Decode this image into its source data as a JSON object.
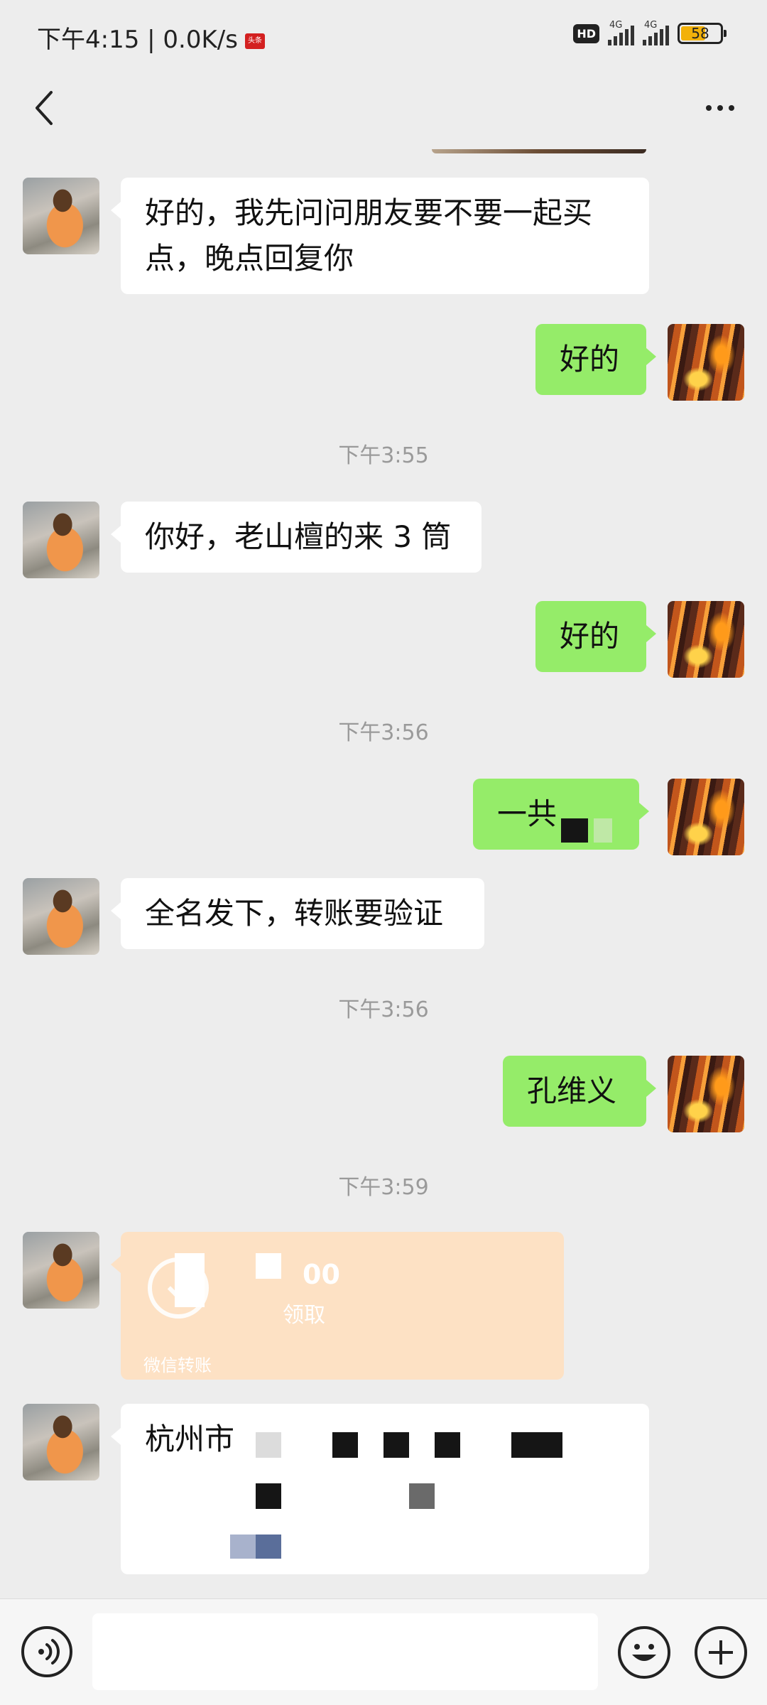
{
  "status_bar": {
    "time_speed": "下午4:15 | 0.0K/s",
    "flag_label": "头条",
    "hd": "HD",
    "network_1": "4G",
    "network_2": "4G",
    "battery": "58"
  },
  "nav": {
    "back_icon": "chevron-left-icon",
    "more_icon": "more-dots-icon"
  },
  "messages": [
    {
      "side": "in",
      "text_line1": "好的，我先问问朋友要不要一起买",
      "text_line2": "点，晚点回复你"
    },
    {
      "side": "out",
      "text": "好的"
    },
    {
      "type": "time",
      "text": "下午3:55"
    },
    {
      "side": "in",
      "text": "你好，老山檀的来 3 筒"
    },
    {
      "side": "out",
      "text": "好的"
    },
    {
      "type": "time",
      "text": "下午3:56"
    },
    {
      "side": "out",
      "text": "一共"
    },
    {
      "side": "in",
      "text": "全名发下，转账要验证"
    },
    {
      "type": "time",
      "text": "下午3:56"
    },
    {
      "side": "out",
      "text": "孔维义"
    },
    {
      "type": "time",
      "text": "下午3:59"
    },
    {
      "side": "in",
      "type": "transfer",
      "amount": "00",
      "status": "领取",
      "footer": "微信转账"
    },
    {
      "side": "in",
      "text": "杭州市"
    }
  ],
  "input_bar": {
    "voice_icon": "voice-icon",
    "emoji_icon": "emoji-icon",
    "plus_icon": "plus-icon",
    "text_value": ""
  },
  "colors": {
    "background": "#ededed",
    "bubble_out": "#95ec69",
    "bubble_in": "#ffffff",
    "transfer": "#fde1c4"
  }
}
